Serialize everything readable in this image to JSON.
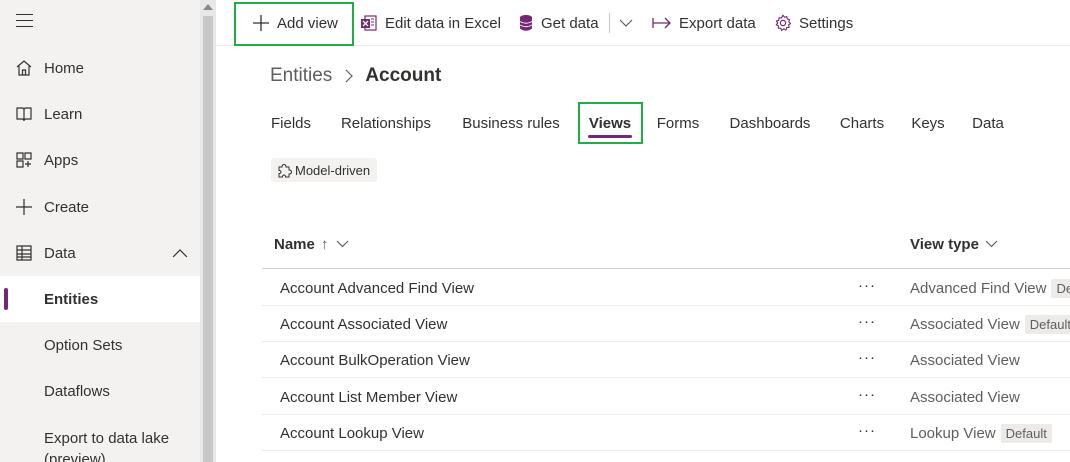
{
  "sidebar": {
    "items": [
      {
        "label": "Home",
        "icon": "home-icon"
      },
      {
        "label": "Learn",
        "icon": "book-icon"
      },
      {
        "label": "Apps",
        "icon": "apps-icon"
      },
      {
        "label": "Create",
        "icon": "plus-icon"
      },
      {
        "label": "Data",
        "icon": "table-icon",
        "expanded": true
      }
    ],
    "sub_items": [
      {
        "label": "Entities",
        "active": true
      },
      {
        "label": "Option Sets"
      },
      {
        "label": "Dataflows"
      },
      {
        "label": "Export to data lake (preview)"
      }
    ]
  },
  "toolbar": {
    "add_view": "Add view",
    "edit_excel": "Edit data in Excel",
    "get_data": "Get data",
    "export_data": "Export data",
    "settings": "Settings"
  },
  "breadcrumb": {
    "root": "Entities",
    "current": "Account"
  },
  "tabs": [
    "Fields",
    "Relationships",
    "Business rules",
    "Views",
    "Forms",
    "Dashboards",
    "Charts",
    "Keys",
    "Data"
  ],
  "active_tab": "Views",
  "chip": {
    "label": "Model-driven"
  },
  "table": {
    "columns": {
      "name": "Name",
      "name_sort": "↑",
      "view_type": "View type"
    },
    "rows": [
      {
        "name": "Account Advanced Find View",
        "more": "···",
        "view_type": "Advanced Find View",
        "badge": "De"
      },
      {
        "name": "Account Associated View",
        "more": "···",
        "view_type": "Associated View",
        "badge": "Default"
      },
      {
        "name": "Account BulkOperation View",
        "more": "···",
        "view_type": "Associated View",
        "badge": ""
      },
      {
        "name": "Account List Member View",
        "more": "···",
        "view_type": "Associated View",
        "badge": ""
      },
      {
        "name": "Account Lookup View",
        "more": "···",
        "view_type": "Lookup View",
        "badge": "Default"
      }
    ]
  },
  "colors": {
    "accent": "#742774",
    "highlight": "#1fae45",
    "sidebar_bg": "#f3f2f1",
    "excel": "#217346"
  }
}
